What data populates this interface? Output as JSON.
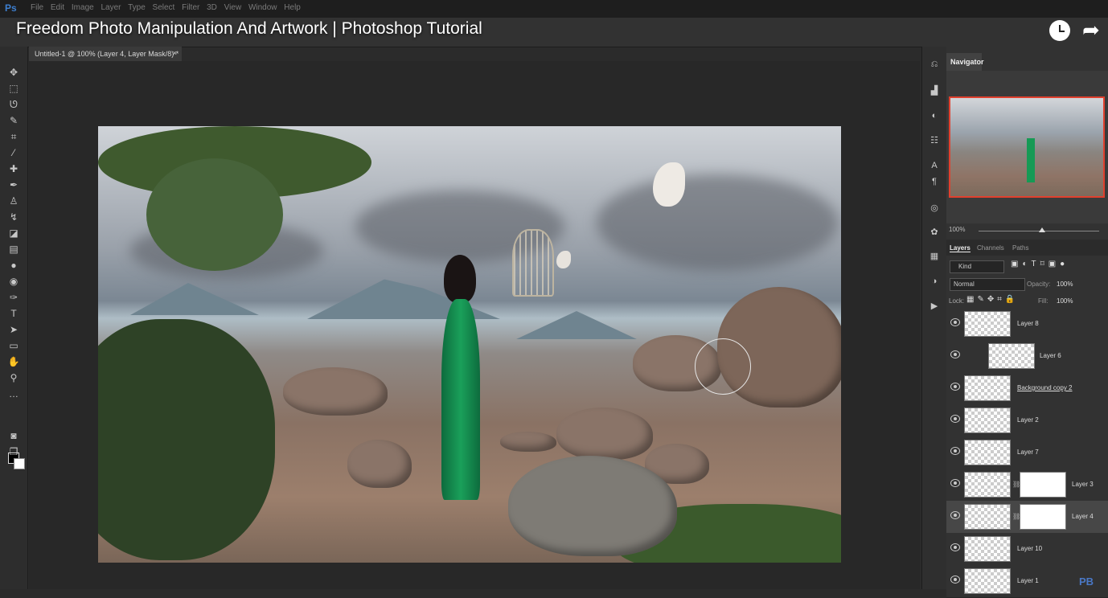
{
  "app": {
    "logo": "Ps",
    "menu": [
      "File",
      "Edit",
      "Image",
      "Layer",
      "Type",
      "Select",
      "Filter",
      "3D",
      "View",
      "Window",
      "Help"
    ]
  },
  "video": {
    "title": "Freedom Photo Manipulation And Artwork | Photoshop Tutorial"
  },
  "document": {
    "tab_label": "Untitled-1 @ 100% (Layer 4, Layer Mask/8) *",
    "close_glyph": "×"
  },
  "navigator": {
    "tab_label": "Navigator",
    "zoom": "100%"
  },
  "layers_panel": {
    "tabs": [
      "Layers",
      "Channels",
      "Paths"
    ],
    "filter_kind": "Kind",
    "blend_mode": "Normal",
    "opacity_label": "Opacity:",
    "opacity": "100%",
    "lock_label": "Lock:",
    "fill_label": "Fill:",
    "fill": "100%",
    "layers": [
      {
        "name": "Layer 8",
        "mask": false,
        "selected": false
      },
      {
        "name": "Layer 6",
        "mask": false,
        "selected": false,
        "clipped": true
      },
      {
        "name": "Background copy 2",
        "mask": false,
        "selected": false
      },
      {
        "name": "Layer 2",
        "mask": false,
        "selected": false
      },
      {
        "name": "Layer 7",
        "mask": false,
        "selected": false
      },
      {
        "name": "Layer 3",
        "mask": true,
        "selected": false
      },
      {
        "name": "Layer 4",
        "mask": true,
        "selected": true
      },
      {
        "name": "Layer 10",
        "mask": false,
        "selected": false
      },
      {
        "name": "Layer 1",
        "mask": false,
        "selected": false
      }
    ]
  },
  "colors": {
    "accent_red": "#e0402e",
    "dress_green": "#1aa05a"
  },
  "icons": {
    "tools": [
      "move-icon",
      "marquee-icon",
      "lasso-icon",
      "quick-select-icon",
      "crop-icon",
      "eyedropper-icon",
      "healing-icon",
      "brush-icon",
      "stamp-icon",
      "history-brush-icon",
      "eraser-icon",
      "gradient-icon",
      "blur-icon",
      "dodge-icon",
      "pen-icon",
      "type-icon",
      "path-select-icon",
      "shape-icon",
      "hand-icon",
      "zoom-icon",
      "more-icon"
    ],
    "panel_strip": [
      "history-icon",
      "histogram-icon",
      "adjustments-icon",
      "properties-icon",
      "character-icon",
      "paragraph-icon",
      "libraries-icon",
      "brush-settings-icon",
      "swatches-icon",
      "styles-icon",
      "actions-icon"
    ]
  },
  "watermark": "PB"
}
